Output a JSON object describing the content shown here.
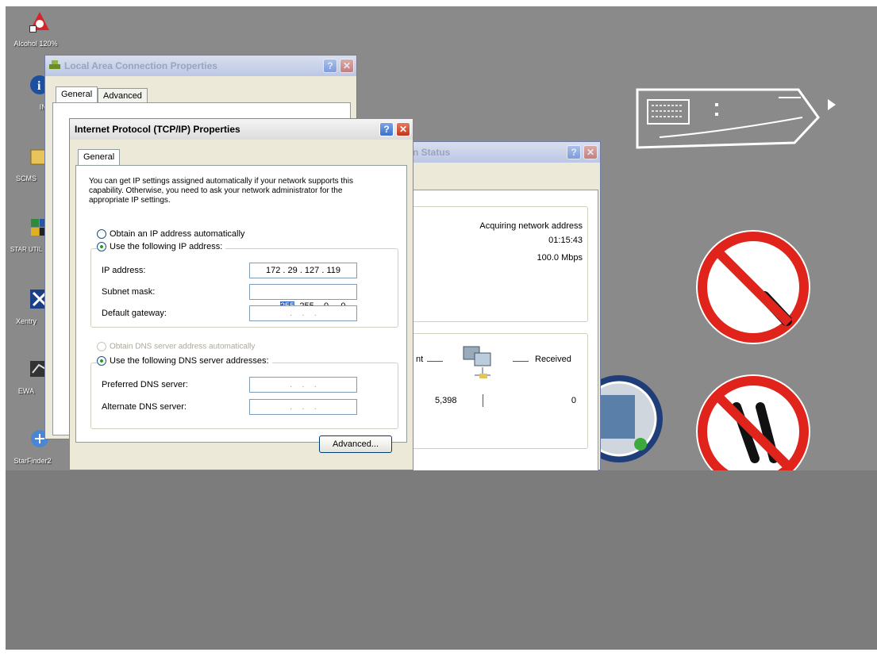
{
  "desktop_icons": [
    {
      "label": "Alcohol 120%",
      "icon": "alcohol-icon"
    },
    {
      "label": "INF",
      "icon": "info-icon"
    },
    {
      "label": "SCMS",
      "icon": "folder-icon"
    },
    {
      "label": "STAR UTILITIES",
      "icon": "star-utilities-icon"
    },
    {
      "label": "Xentry",
      "icon": "xentry-icon"
    },
    {
      "label": "EWA",
      "icon": "ewa-icon"
    },
    {
      "label": "StarFinder2",
      "icon": "starfinder-icon"
    }
  ],
  "lac_window": {
    "title": "Local Area Connection Properties",
    "tabs": [
      "General",
      "Advanced"
    ]
  },
  "status_window": {
    "title_fragment": "n Status",
    "status": "Acquiring network address",
    "duration": "01:15:43",
    "speed": "100.0 Mbps",
    "sent_label": "nt",
    "received_label": "Received",
    "sent_value": "5,398",
    "received_value": "0"
  },
  "tcpip_window": {
    "title": "Internet Protocol (TCP/IP) Properties",
    "tab": "General",
    "description": "You can get IP settings assigned automatically if your network supports this capability. Otherwise, you need to ask your network administrator for the appropriate IP settings.",
    "radio_auto_ip": "Obtain an IP address automatically",
    "radio_manual_ip": "Use the following IP address:",
    "ip_label": "IP address:",
    "ip_value": "172 . 29 . 127 . 119",
    "subnet_label": "Subnet mask:",
    "subnet_selected": "255",
    "subnet_rest": ". 255 .  0  .  0",
    "gateway_label": "Default gateway:",
    "empty_ip": " .    .    . ",
    "radio_auto_dns": "Obtain DNS server address automatically",
    "radio_manual_dns": "Use the following DNS server addresses:",
    "pref_dns_label": "Preferred DNS server:",
    "alt_dns_label": "Alternate DNS server:",
    "advanced_button": "Advanced..."
  },
  "colors": {
    "desktop": "#8a8a8a",
    "prohibit_red": "#e0231b",
    "xp_blue": "#3c6fd0"
  }
}
